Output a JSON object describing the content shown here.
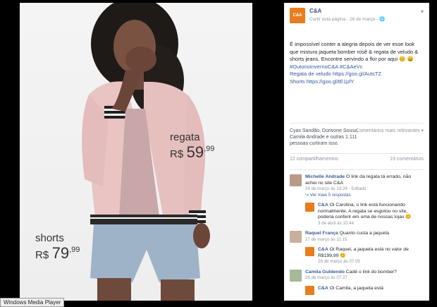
{
  "photo": {
    "regata_label": "regata",
    "regata_currency": "R$",
    "regata_int": "59",
    "regata_cents": ",99",
    "shorts_label": "shorts",
    "shorts_currency": "R$",
    "shorts_int": "79",
    "shorts_cents": ",99"
  },
  "window": {
    "taskbar_label": "Windows Media Player"
  },
  "page": {
    "name": "C&A",
    "logo_text": "C&A",
    "subtitle": "Curtir esta página · 26 de março · 🌐"
  },
  "post": {
    "text": "É impossível conter a alegria depois de ver esse look que mistura jaqueta bomber rosê & regata de veludo & shorts jeans. Encontre servindo a flor por aqui 😊 😄",
    "hashtags": "#OutonoInvernoC&A #C&AeVc",
    "link1": "Regata de veludo https://goo.gl/AutsTZ",
    "link2": "Shorts https://goo.gl/tE1pfY"
  },
  "reactions": {
    "text": "Cyas Sandão, Dorivone Sousa, Camila Andrade e outras 1.111 pessoas curtiram isso.",
    "relevance": "Comentários mais relevantes ▾"
  },
  "counts": {
    "shares": "12 compartilhamentos",
    "comments": "19 comentários"
  },
  "comments": [
    {
      "author": "Michelle Andrade",
      "text": "O link da regata tá errado, não achei no site C&A",
      "meta": "26 de março às 13:24 · Editado",
      "more": "↪ Ver mais 5 respostas"
    },
    {
      "author": "C&A",
      "text": "Oi Carolina, o link está funcionando normalmente. A regata se esgotou no site, poderia conferir em uma de nossas lojas 😊",
      "meta": "3 de abril às 10:44"
    },
    {
      "author": "Raquel França",
      "text": "Quanto custa a jaqueta",
      "meta": "27 de março às 11:15"
    },
    {
      "author": "C&A",
      "text": "Oi Raquel, a jaqueta está no valor de R$199,99 😊",
      "meta": "28 de março às 07:09"
    },
    {
      "author": "Camila Guldendo",
      "text": "Cadê o link do bomber?",
      "meta": "26 de março às 07:27"
    },
    {
      "author": "C&A",
      "text": "Oi Camila, a jaqueta está",
      "meta": ""
    }
  ]
}
